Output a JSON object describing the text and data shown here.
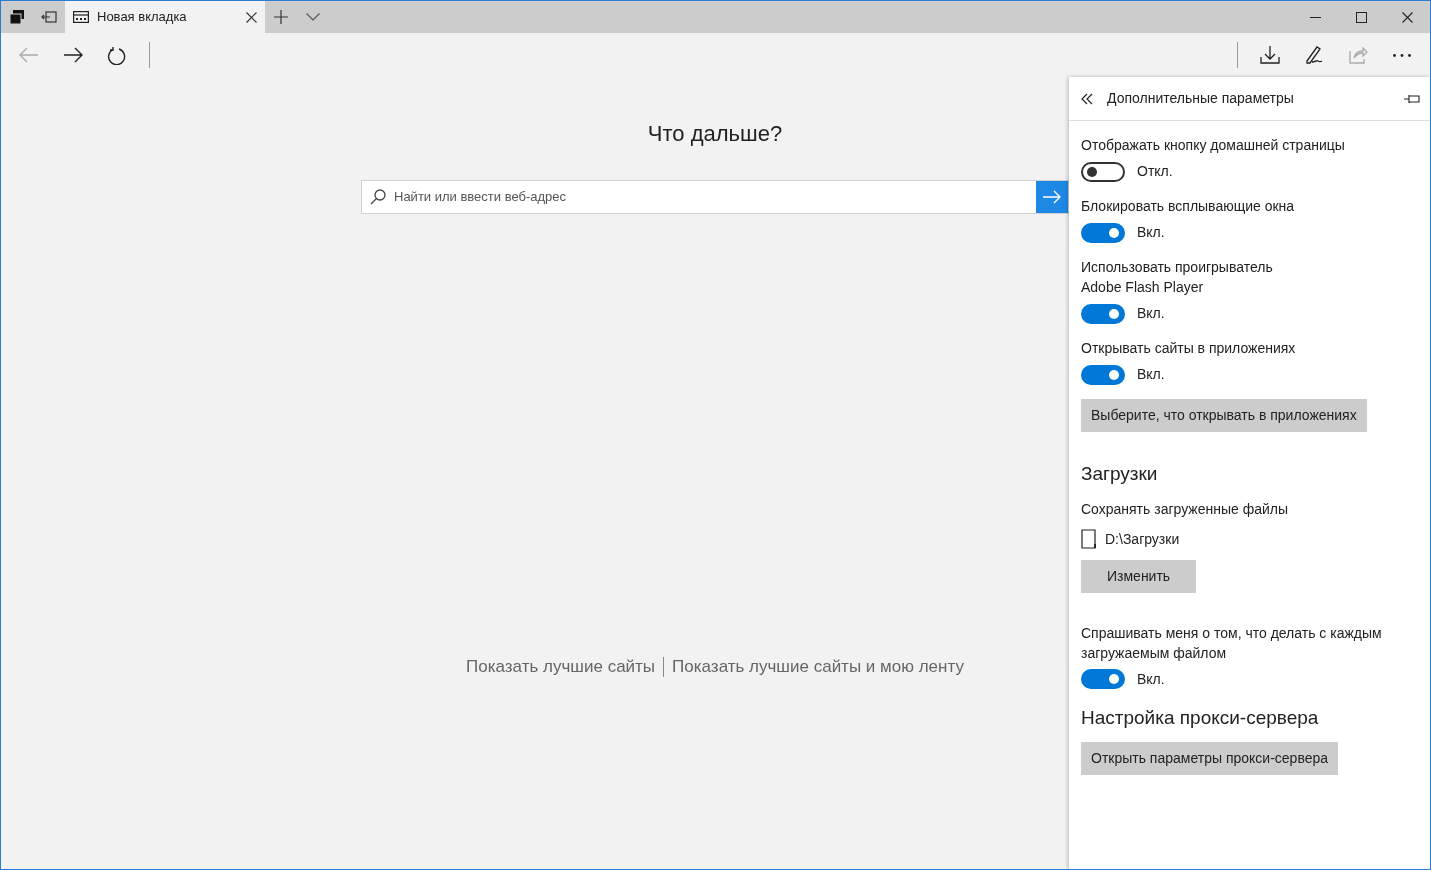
{
  "tabs": [
    {
      "title": "Новая вкладка",
      "selected": true
    }
  ],
  "nav_buttons": [
    {
      "kind": "back",
      "disabled": true
    },
    {
      "kind": "forward",
      "disabled": false
    },
    {
      "kind": "refresh",
      "disabled": false
    }
  ],
  "tool_buttons": [
    {
      "kind": "download",
      "disabled": false
    },
    {
      "kind": "pen",
      "disabled": false
    },
    {
      "kind": "share",
      "disabled": true
    },
    {
      "kind": "more",
      "disabled": false
    }
  ],
  "page": {
    "heading": "Что дальше?",
    "search": {
      "placeholder": "Найти или ввести веб-адрес"
    },
    "links": [
      "Показать лучшие сайты",
      "Показать лучшие сайты и мою ленту"
    ]
  },
  "settings_panel": {
    "title": "Дополнительные параметры",
    "items": [
      {
        "kind": "toggle",
        "label": "Отображать кнопку домашней страницы",
        "on": false,
        "state_text": "Откл."
      },
      {
        "kind": "toggle",
        "label": "Блокировать всплывающие окна",
        "on": true,
        "state_text": "Вкл."
      },
      {
        "kind": "toggle",
        "label": "Использовать проигрыватель\nAdobe Flash Player",
        "on": true,
        "state_text": "Вкл."
      },
      {
        "kind": "toggle",
        "label": "Открывать сайты в приложениях",
        "on": true,
        "state_text": "Вкл."
      },
      {
        "kind": "button",
        "label": "Выберите, что открывать в приложениях"
      },
      {
        "kind": "heading",
        "label": "Загрузки"
      },
      {
        "kind": "text",
        "label": "Сохранять загруженные файлы"
      },
      {
        "kind": "path",
        "label": "D:\\Загрузки"
      },
      {
        "kind": "button",
        "label": "Изменить",
        "wide": true
      },
      {
        "kind": "toggle",
        "label": "Спрашивать меня о том, что делать с каждым загружаемым файлом",
        "on": true,
        "state_text": "Вкл."
      },
      {
        "kind": "heading",
        "label": "Настройка прокси-сервера"
      },
      {
        "kind": "button",
        "label": "Открыть параметры прокси-сервера"
      }
    ]
  }
}
